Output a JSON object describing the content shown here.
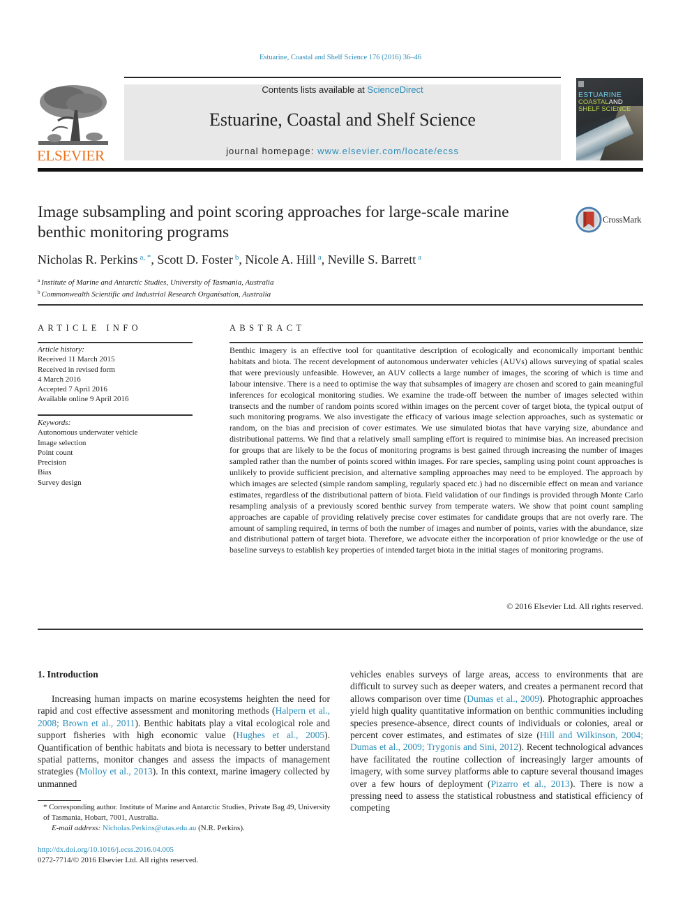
{
  "citation": "Estuarine, Coastal and Shelf Science 176 (2016) 36–46",
  "publisher": {
    "name": "ELSEVIER",
    "brand_color": "#e9711c"
  },
  "masthead": {
    "contents_prefix": "Contents lists available at ",
    "contents_link": "ScienceDirect",
    "journal_name": "Estuarine, Coastal and Shelf Science",
    "homepage_prefix": "journal homepage: ",
    "homepage_link": "www.elsevier.com/locate/ecss",
    "link_color": "#2a8bb7",
    "background": "#e8e8e8"
  },
  "cover": {
    "line1": "ESTUARINE",
    "line2a": "COASTAL",
    "line2b": "AND",
    "line3": "SHELF SCIENCE"
  },
  "crossmark": {
    "label": "CrossMark",
    "icon": "crossmark-icon"
  },
  "article": {
    "title": "Image subsampling and point scoring approaches for large-scale marine benthic monitoring programs",
    "authors": [
      {
        "name": "Nicholas R. Perkins",
        "sup": "a, *"
      },
      {
        "name": "Scott D. Foster",
        "sup": "b"
      },
      {
        "name": "Nicole A. Hill",
        "sup": "a"
      },
      {
        "name": "Neville S. Barrett",
        "sup": "a"
      }
    ],
    "affiliations": [
      {
        "key": "a",
        "text": "Institute of Marine and Antarctic Studies, University of Tasmania, Australia"
      },
      {
        "key": "b",
        "text": "Commonwealth Scientific and Industrial Research Organisation, Australia"
      }
    ]
  },
  "article_info": {
    "heading": "ARTICLE INFO",
    "history_label": "Article history:",
    "history": [
      "Received 11 March 2015",
      "Received in revised form",
      "4 March 2016",
      "Accepted 7 April 2016",
      "Available online 9 April 2016"
    ],
    "keywords_label": "Keywords:",
    "keywords": [
      "Autonomous underwater vehicle",
      "Image selection",
      "Point count",
      "Precision",
      "Bias",
      "Survey design"
    ]
  },
  "abstract": {
    "heading": "ABSTRACT",
    "text": "Benthic imagery is an effective tool for quantitative description of ecologically and economically important benthic habitats and biota. The recent development of autonomous underwater vehicles (AUVs) allows surveying of spatial scales that were previously unfeasible. However, an AUV collects a large number of images, the scoring of which is time and labour intensive. There is a need to optimise the way that subsamples of imagery are chosen and scored to gain meaningful inferences for ecological monitoring studies. We examine the trade-off between the number of images selected within transects and the number of random points scored within images on the percent cover of target biota, the typical output of such monitoring programs. We also investigate the efficacy of various image selection approaches, such as systematic or random, on the bias and precision of cover estimates. We use simulated biotas that have varying size, abundance and distributional patterns. We find that a relatively small sampling effort is required to minimise bias. An increased precision for groups that are likely to be the focus of monitoring programs is best gained through increasing the number of images sampled rather than the number of points scored within images. For rare species, sampling using point count approaches is unlikely to provide sufficient precision, and alternative sampling approaches may need to be employed. The approach by which images are selected (simple random sampling, regularly spaced etc.) had no discernible effect on mean and variance estimates, regardless of the distributional pattern of biota. Field validation of our findings is provided through Monte Carlo resampling analysis of a previously scored benthic survey from temperate waters. We show that point count sampling approaches are capable of providing relatively precise cover estimates for candidate groups that are not overly rare. The amount of sampling required, in terms of both the number of images and number of points, varies with the abundance, size and distributional pattern of target biota. Therefore, we advocate either the incorporation of prior knowledge or the use of baseline surveys to establish key properties of intended target biota in the initial stages of monitoring programs.",
    "copyright": "© 2016 Elsevier Ltd. All rights reserved."
  },
  "introduction": {
    "heading": "1.  Introduction",
    "left": [
      {
        "t": "Increasing human impacts on marine ecosystems heighten the need for rapid and cost effective assessment and monitoring methods ("
      },
      {
        "link": "Halpern et al., 2008; Brown et al., 2011"
      },
      {
        "t": "). Benthic habitats play a vital ecological role and support fisheries with high economic value ("
      },
      {
        "link": "Hughes et al., 2005"
      },
      {
        "t": "). Quantification of benthic habitats and biota is necessary to better understand spatial patterns, monitor changes and assess the impacts of management strategies ("
      },
      {
        "link": "Molloy et al., 2013"
      },
      {
        "t": "). In this context, marine imagery collected by unmanned"
      }
    ],
    "right": [
      {
        "t": "vehicles enables surveys of large areas, access to environments that are difficult to survey such as deeper waters, and creates a permanent record that allows comparison over time ("
      },
      {
        "link": "Dumas et al., 2009"
      },
      {
        "t": "). Photographic approaches yield high quality quantitative information on benthic communities including species presence-absence, direct counts of individuals or colonies, areal or percent cover estimates, and estimates of size ("
      },
      {
        "link": "Hill and Wilkinson, 2004; Dumas et al., 2009; Trygonis and Sini, 2012"
      },
      {
        "t": "). Recent technological advances have facilitated the routine collection of increasingly larger amounts of imagery, with some survey platforms able to capture several thousand images over a few hours of deployment ("
      },
      {
        "link": "Pizarro et al., 2013"
      },
      {
        "t": "). There is now a pressing need to assess the statistical robustness and statistical efficiency of competing"
      }
    ]
  },
  "footnote": {
    "corresponding": "* Corresponding author. Institute of Marine and Antarctic Studies, Private Bag 49, University of Tasmania, Hobart, 7001, Australia.",
    "email_label": "E-mail address: ",
    "email": "Nicholas.Perkins@utas.edu.au",
    "email_suffix": " (N.R. Perkins)."
  },
  "doi": {
    "link": "http://dx.doi.org/10.1016/j.ecss.2016.04.005",
    "issn_line": "0272-7714/© 2016 Elsevier Ltd. All rights reserved."
  }
}
